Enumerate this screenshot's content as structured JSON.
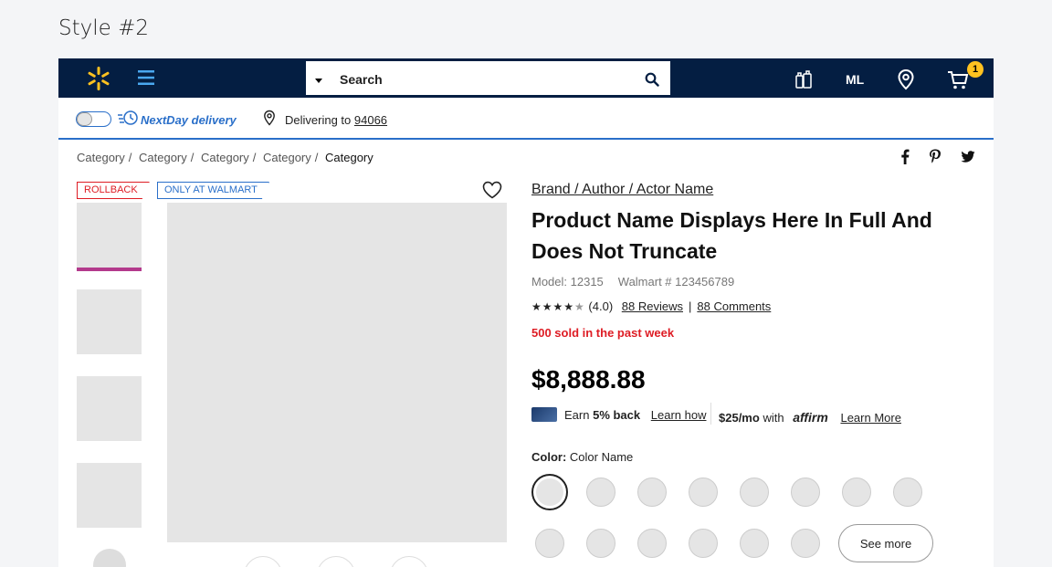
{
  "page_heading": "Style #2",
  "header": {
    "search_placeholder": "Search",
    "account_initials": "ML",
    "cart_count": "1",
    "colors": {
      "bar": "#041e42",
      "spark": "#ffc220"
    }
  },
  "delivery": {
    "nextday_label": "NextDay delivery",
    "delivering_prefix": "Delivering to",
    "zip": "94066"
  },
  "breadcrumb": [
    "Category",
    "Category",
    "Category",
    "Category",
    "Category"
  ],
  "flags": {
    "rollback": "ROLLBACK",
    "only_at": "ONLY AT WALMART"
  },
  "product": {
    "brand": "Brand / Author / Actor Name",
    "name": "Product Name Displays Here In Full And Does Not Truncate",
    "model": "Model: 12315",
    "walmart_id": "Walmart # 123456789",
    "rating_value": "(4.0)",
    "stars": 4,
    "reviews": "88 Reviews",
    "comments": "88 Comments",
    "sold_note": "500 sold in the past week",
    "price": "$8,888.88"
  },
  "offers": {
    "earn_prefix": "Earn",
    "earn_bold": "5% back",
    "learn_how": "Learn how",
    "monthly": "$25/mo",
    "with": "with",
    "affirm_logo": "affirm",
    "learn_more": "Learn More"
  },
  "color": {
    "label": "Color",
    "value": "Color Name",
    "see_more": "See more"
  }
}
